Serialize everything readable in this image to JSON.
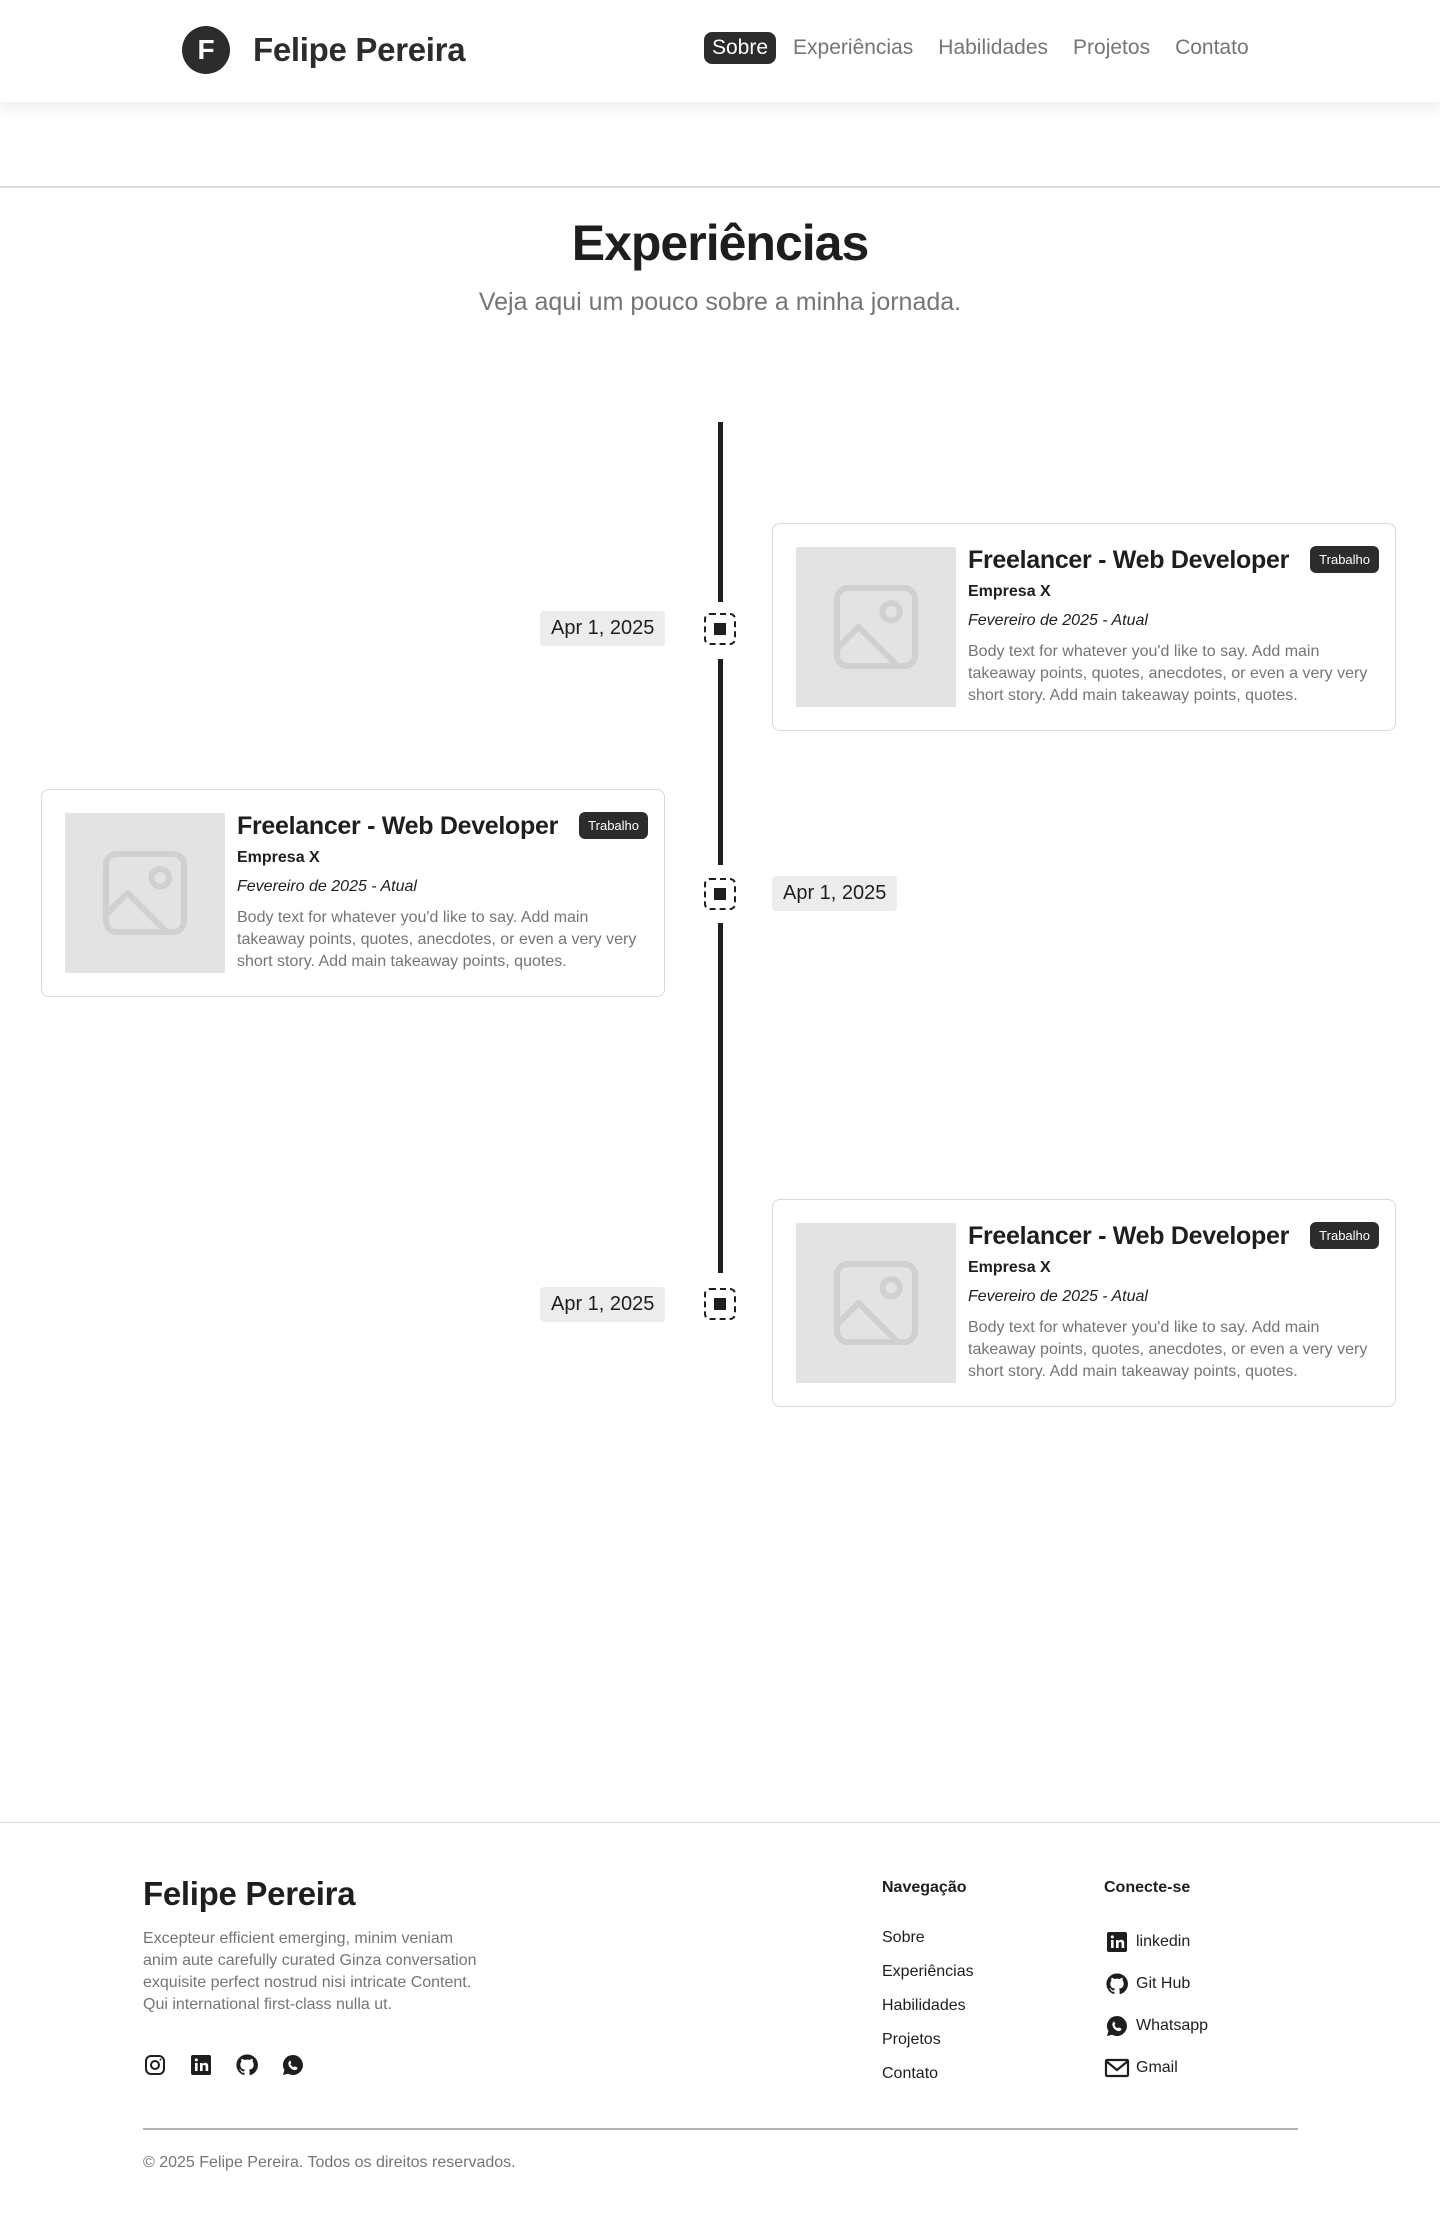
{
  "header": {
    "logo_letter": "F",
    "brand": "Felipe Pereira",
    "nav": [
      {
        "label": "Sobre",
        "active": true
      },
      {
        "label": "Experiências",
        "active": false
      },
      {
        "label": "Habilidades",
        "active": false
      },
      {
        "label": "Projetos",
        "active": false
      },
      {
        "label": "Contato",
        "active": false
      }
    ]
  },
  "section": {
    "title": "Experiências",
    "subtitle": "Veja aqui um pouco sobre a minha jornada."
  },
  "timeline": [
    {
      "date": "Apr 1, 2025",
      "title": "Freelancer - Web Developer",
      "badge": "Trabalho",
      "company": "Empresa X",
      "period": "Fevereiro de 2025 - Atual",
      "body": "Body text for whatever you'd like to say. Add main takeaway points, quotes, anecdotes, or even a very very short story. Add main takeaway points, quotes.",
      "image_icon": "image-placeholder-icon"
    },
    {
      "date": "Apr 1, 2025",
      "title": "Freelancer - Web Developer",
      "badge": "Trabalho",
      "company": "Empresa X",
      "period": "Fevereiro de 2025 - Atual",
      "body": "Body text for whatever you'd like to say. Add main takeaway points, quotes, anecdotes, or even a very very short story. Add main takeaway points, quotes.",
      "image_icon": "image-placeholder-icon"
    },
    {
      "date": "Apr 1, 2025",
      "title": "Freelancer - Web Developer",
      "badge": "Trabalho",
      "company": "Empresa X",
      "period": "Fevereiro de 2025 - Atual",
      "body": "Body text for whatever you'd like to say. Add main takeaway points, quotes, anecdotes, or even a very very short story. Add main takeaway points, quotes.",
      "image_icon": "image-placeholder-icon"
    }
  ],
  "footer": {
    "brand": "Felipe Pereira",
    "description": "Excepteur efficient emerging, minim veniam anim aute carefully curated Ginza conversation exquisite perfect nostrud nisi intricate Content. Qui  international first-class nulla ut.",
    "social_icons": [
      "instagram-icon",
      "linkedin-icon",
      "github-icon",
      "whatsapp-icon"
    ],
    "nav_title": "Navegação",
    "nav_links": [
      "Sobre",
      "Experiências",
      "Habilidades",
      "Projetos",
      "Contato"
    ],
    "connect_title": "Conecte-se",
    "connect_links": [
      {
        "label": "linkedin",
        "icon": "linkedin-icon"
      },
      {
        "label": "Git Hub",
        "icon": "github-icon"
      },
      {
        "label": "Whatsapp",
        "icon": "whatsapp-icon"
      },
      {
        "label": "Gmail",
        "icon": "mail-icon"
      }
    ],
    "copyright": "© 2025 Felipe Pereira. Todos os direitos reservados."
  },
  "colors": {
    "primary": "#2c2c2c",
    "text": "#1e1e1e",
    "muted": "#757575",
    "border": "#d9d9d9",
    "placeholder": "#e3e3e3"
  }
}
